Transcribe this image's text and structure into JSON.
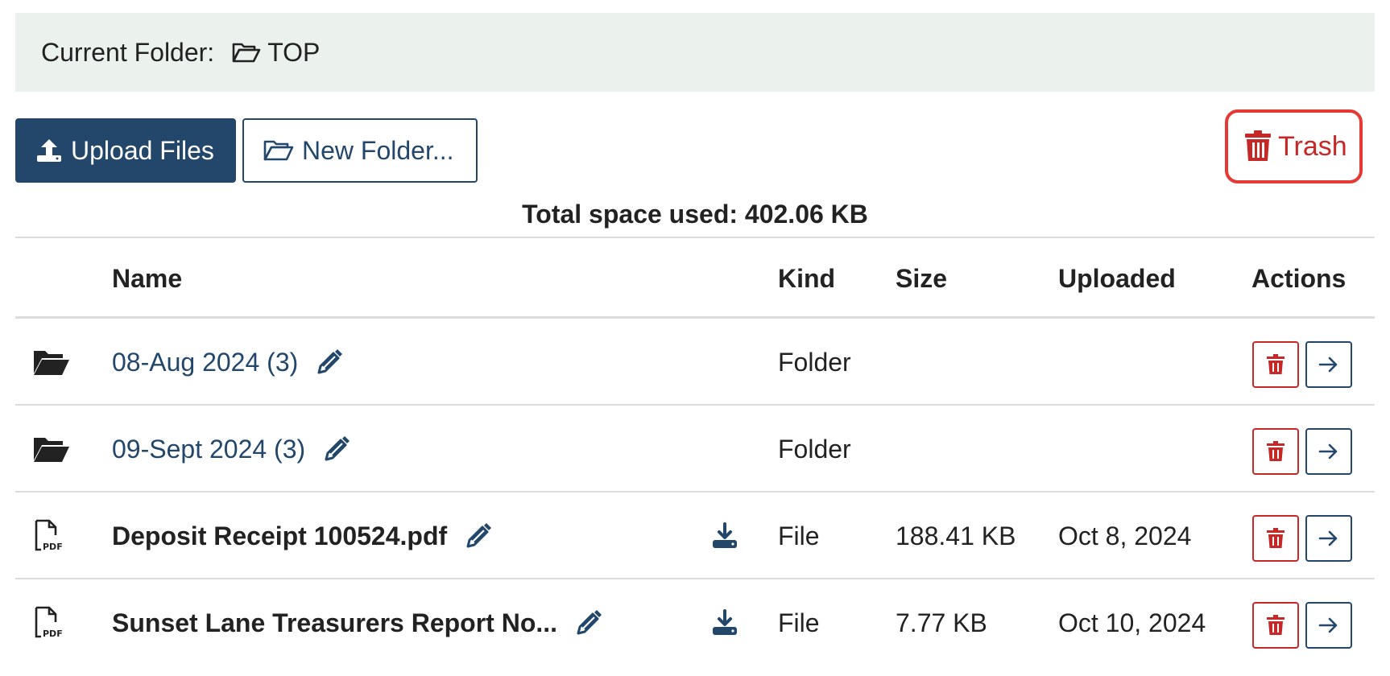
{
  "breadcrumb": {
    "label": "Current Folder:",
    "folder_name": "TOP",
    "icon": "folder-open-icon"
  },
  "toolbar": {
    "upload_label": "Upload Files",
    "new_folder_label": "New Folder...",
    "trash_label": "Trash"
  },
  "summary": {
    "total_space_label": "Total space used: 402.06 KB"
  },
  "table": {
    "headers": {
      "name": "Name",
      "kind": "Kind",
      "size": "Size",
      "uploaded": "Uploaded",
      "actions": "Actions"
    },
    "rows": [
      {
        "icon": "folder-open-icon",
        "name": "08-Aug 2024 (3)",
        "kind": "Folder",
        "size": "",
        "uploaded": "",
        "is_file": false
      },
      {
        "icon": "folder-open-icon",
        "name": "09-Sept 2024 (3)",
        "kind": "Folder",
        "size": "",
        "uploaded": "",
        "is_file": false
      },
      {
        "icon": "pdf-file-icon",
        "name": "Deposit Receipt 100524.pdf",
        "kind": "File",
        "size": "188.41 KB",
        "uploaded": "Oct 8, 2024",
        "is_file": true
      },
      {
        "icon": "pdf-file-icon",
        "name": "Sunset Lane Treasurers Report No...",
        "kind": "File",
        "size": "7.77 KB",
        "uploaded": "Oct 10, 2024",
        "is_file": true
      }
    ]
  },
  "colors": {
    "primary": "#23476b",
    "danger": "#c62828",
    "breadcrumb_bg": "#ebf1ec"
  }
}
